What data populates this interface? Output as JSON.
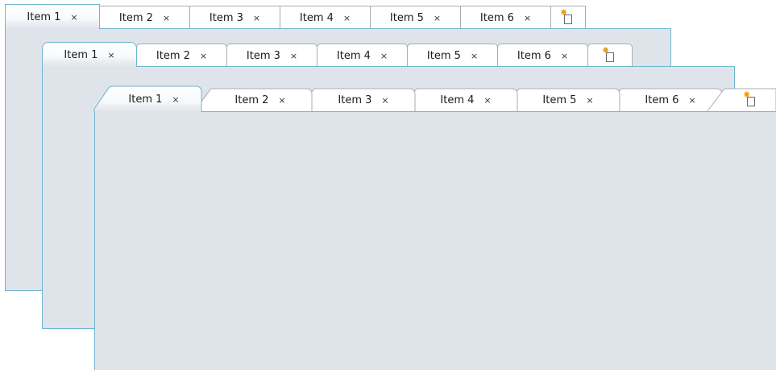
{
  "tabsets": [
    {
      "style": "flat",
      "tabs": [
        {
          "label": "Item 1",
          "close": "×",
          "active": true
        },
        {
          "label": "Item 2",
          "close": "×"
        },
        {
          "label": "Item 3",
          "close": "×"
        },
        {
          "label": "Item 4",
          "close": "×"
        },
        {
          "label": "Item 5",
          "close": "×"
        },
        {
          "label": "Item 6",
          "close": "×"
        }
      ],
      "new_tab_icon": "new-tab-icon"
    },
    {
      "style": "rounded",
      "tabs": [
        {
          "label": "Item 1",
          "close": "×",
          "active": true
        },
        {
          "label": "Item 2",
          "close": "×"
        },
        {
          "label": "Item 3",
          "close": "×"
        },
        {
          "label": "Item 4",
          "close": "×"
        },
        {
          "label": "Item 5",
          "close": "×"
        },
        {
          "label": "Item 6",
          "close": "×"
        }
      ],
      "new_tab_icon": "new-tab-icon"
    },
    {
      "style": "slanted",
      "tabs": [
        {
          "label": "Item 1",
          "close": "×",
          "active": true
        },
        {
          "label": "Item 2",
          "close": "×"
        },
        {
          "label": "Item 3",
          "close": "×"
        },
        {
          "label": "Item 4",
          "close": "×"
        },
        {
          "label": "Item 5",
          "close": "×"
        },
        {
          "label": "Item 6",
          "close": "×"
        }
      ],
      "new_tab_icon": "new-tab-icon"
    }
  ],
  "colors": {
    "panel_bg": "#dfe3ea",
    "panel_border": "#6fb6cf",
    "tab_border": "#a7adb5",
    "new_tab_star": "#f0a010"
  }
}
